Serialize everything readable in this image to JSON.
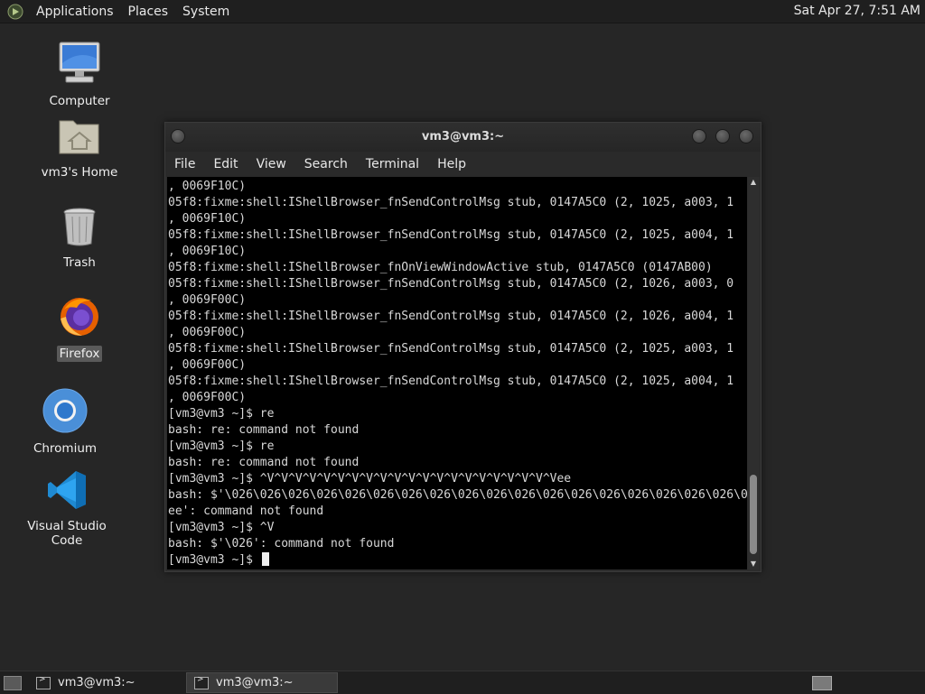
{
  "top_panel": {
    "menus": [
      "Applications",
      "Places",
      "System"
    ],
    "clock": "Sat Apr 27,  7:51 AM"
  },
  "desktop": {
    "icons": [
      {
        "label": "Computer",
        "icon": "computer-icon"
      },
      {
        "label": "vm3's Home",
        "icon": "home-folder-icon"
      },
      {
        "label": "Trash",
        "icon": "trash-icon"
      },
      {
        "label": "Firefox",
        "icon": "firefox-icon",
        "selected": true
      },
      {
        "label": "Chromium",
        "icon": "chromium-icon"
      },
      {
        "label": "Visual Studio Code",
        "icon": "vscode-icon"
      }
    ]
  },
  "terminal": {
    "title": "vm3@vm3:~",
    "menu": [
      "File",
      "Edit",
      "View",
      "Search",
      "Terminal",
      "Help"
    ],
    "lines": [
      ", 0069F10C)",
      "05f8:fixme:shell:IShellBrowser_fnSendControlMsg stub, 0147A5C0 (2, 1025, a003, 1",
      ", 0069F10C)",
      "05f8:fixme:shell:IShellBrowser_fnSendControlMsg stub, 0147A5C0 (2, 1025, a004, 1",
      ", 0069F10C)",
      "05f8:fixme:shell:IShellBrowser_fnOnViewWindowActive stub, 0147A5C0 (0147AB00)",
      "05f8:fixme:shell:IShellBrowser_fnSendControlMsg stub, 0147A5C0 (2, 1026, a003, 0",
      ", 0069F00C)",
      "05f8:fixme:shell:IShellBrowser_fnSendControlMsg stub, 0147A5C0 (2, 1026, a004, 1",
      ", 0069F00C)",
      "05f8:fixme:shell:IShellBrowser_fnSendControlMsg stub, 0147A5C0 (2, 1025, a003, 1",
      ", 0069F00C)",
      "05f8:fixme:shell:IShellBrowser_fnSendControlMsg stub, 0147A5C0 (2, 1025, a004, 1",
      ", 0069F00C)",
      "[vm3@vm3 ~]$ re",
      "bash: re: command not found",
      "[vm3@vm3 ~]$ re",
      "bash: re: command not found",
      "[vm3@vm3 ~]$ ^V^V^V^V^V^V^V^V^V^V^V^V^V^V^V^V^V^V^V^V^Vee",
      "bash: $'\\026\\026\\026\\026\\026\\026\\026\\026\\026\\026\\026\\026\\026\\026\\026\\026\\026\\026\\026\\026",
      "ee': command not found",
      "[vm3@vm3 ~]$ ^V",
      "bash: $'\\026': command not found"
    ],
    "prompt": "[vm3@vm3 ~]$ "
  },
  "taskbar": {
    "tasks": [
      {
        "label": "vm3@vm3:~",
        "active": false
      },
      {
        "label": "vm3@vm3:~",
        "active": true
      }
    ]
  }
}
